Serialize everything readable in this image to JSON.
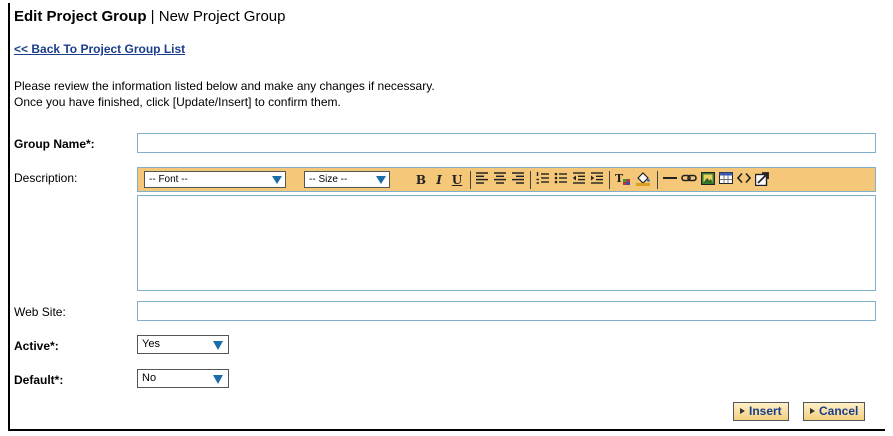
{
  "header": {
    "title_bold": "Edit Project Group",
    "title_sep": " | ",
    "title_rest": "New Project Group",
    "back_link": "<< Back To Project Group List"
  },
  "intro": {
    "line1": "Please review the information listed below and make any changes if necessary.",
    "line2": "Once you have finished, click [Update/Insert] to confirm them."
  },
  "form": {
    "group_name_label": "Group Name*:",
    "group_name_value": "",
    "description_label": "Description:",
    "web_site_label": "Web Site:",
    "web_site_value": "",
    "active_label": "Active*:",
    "active_value": "Yes",
    "default_label": "Default*:",
    "default_value": "No"
  },
  "editor": {
    "font_select": "-- Font --",
    "size_select": "-- Size --",
    "bold": "B",
    "italic": "I",
    "underline": "U",
    "tools": [
      "align-left-icon",
      "align-center-icon",
      "align-right-icon",
      "ordered-list-icon",
      "unordered-list-icon",
      "outdent-icon",
      "indent-icon",
      "text-color-icon",
      "background-color-icon",
      "horizontal-rule-icon",
      "link-icon",
      "image-icon",
      "table-icon",
      "source-code-icon",
      "fullscreen-icon"
    ]
  },
  "actions": {
    "insert_label": "Insert",
    "cancel_label": "Cancel"
  },
  "colors": {
    "toolbar_bg": "#f5c778",
    "field_border": "#7fb0cc",
    "link": "#1a3e8a",
    "arrow": "#1a6ea8"
  }
}
